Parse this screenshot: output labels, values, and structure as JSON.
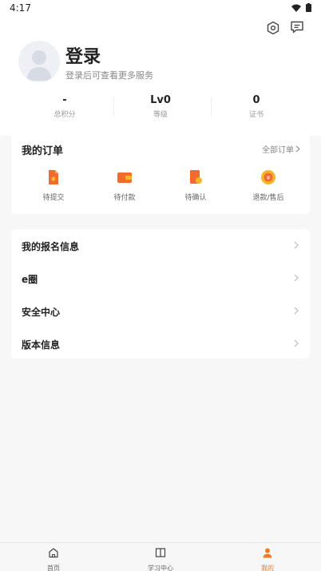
{
  "status_bar": {
    "time": "4:17"
  },
  "header": {
    "settings_icon": "hexagon-settings-icon",
    "message_icon": "message-icon"
  },
  "profile": {
    "title": "登录",
    "subtitle": "登录后可查看更多服务",
    "avatar_icon": "default-avatar-icon"
  },
  "stats": [
    {
      "value": "-",
      "label": "总积分"
    },
    {
      "value": "Lv0",
      "label": "等级"
    },
    {
      "value": "0",
      "label": "证书"
    }
  ],
  "orders": {
    "title": "我的订单",
    "all_label": "全部订单",
    "items": [
      {
        "label": "待提交",
        "icon": "file-icon"
      },
      {
        "label": "待付款",
        "icon": "wallet-icon"
      },
      {
        "label": "待确认",
        "icon": "document-check-icon"
      },
      {
        "label": "退款/售后",
        "icon": "refund-icon"
      }
    ]
  },
  "menu": [
    {
      "label": "我的报名信息"
    },
    {
      "label": "e圈"
    },
    {
      "label": "安全中心"
    },
    {
      "label": "版本信息"
    }
  ],
  "tabs": [
    {
      "label": "首页",
      "icon": "home-icon"
    },
    {
      "label": "学习中心",
      "icon": "book-icon"
    },
    {
      "label": "我的",
      "icon": "user-icon"
    }
  ],
  "colors": {
    "accent": "#f07a22",
    "orange": "#f26a2e",
    "yellow": "#f5b52a"
  }
}
